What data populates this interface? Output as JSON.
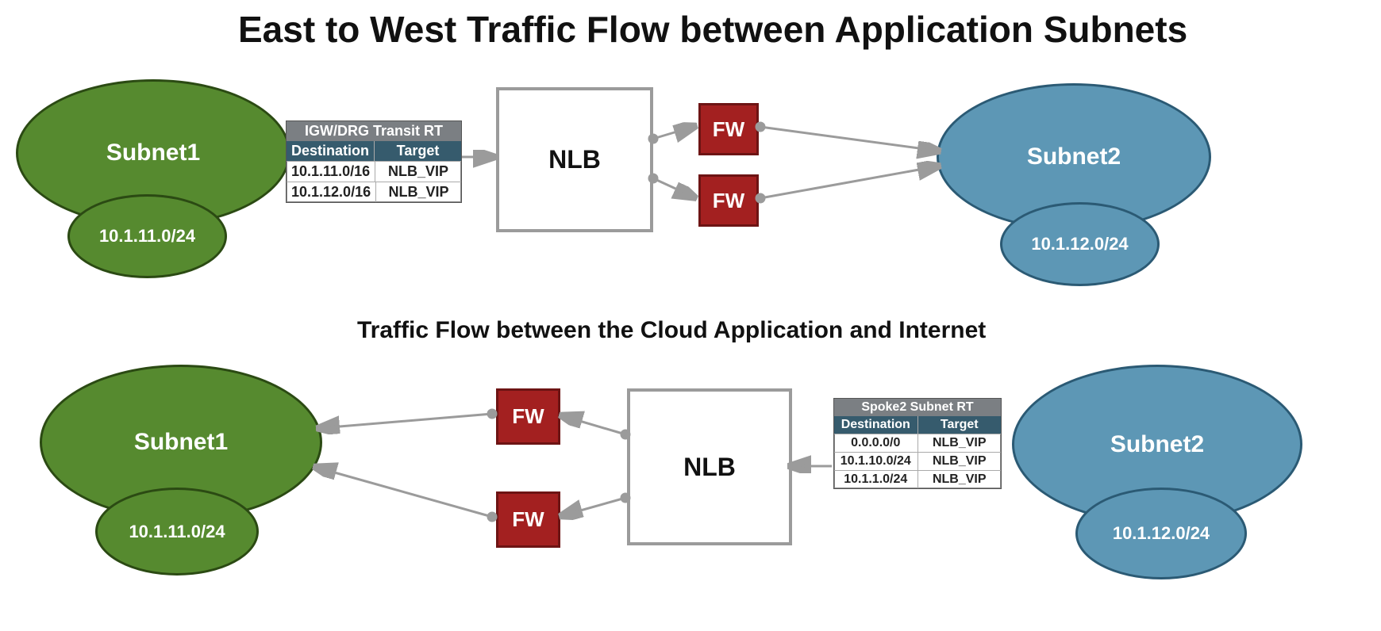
{
  "title": "East to West Traffic Flow between Application Subnets",
  "subtitle": "Traffic Flow between the Cloud Application and Internet",
  "subnet1_label": "Subnet1",
  "subnet1_cidr": "10.1.11.0/24",
  "subnet2_label": "Subnet2",
  "subnet2_cidr": "10.1.12.0/24",
  "nlb_label": "NLB",
  "fw_label": "FW",
  "rt_top": {
    "title": "IGW/DRG Transit RT",
    "col1": "Destination",
    "col2": "Target",
    "rows": [
      {
        "dest": "10.1.11.0/16",
        "target": "NLB_VIP"
      },
      {
        "dest": "10.1.12.0/16",
        "target": "NLB_VIP"
      }
    ]
  },
  "rt_bottom": {
    "title": "Spoke2 Subnet RT",
    "col1": "Destination",
    "col2": "Target",
    "rows": [
      {
        "dest": "0.0.0.0/0",
        "target": "NLB_VIP"
      },
      {
        "dest": "10.1.10.0/24",
        "target": "NLB_VIP"
      },
      {
        "dest": "10.1.1.0/24",
        "target": "NLB_VIP"
      }
    ]
  }
}
